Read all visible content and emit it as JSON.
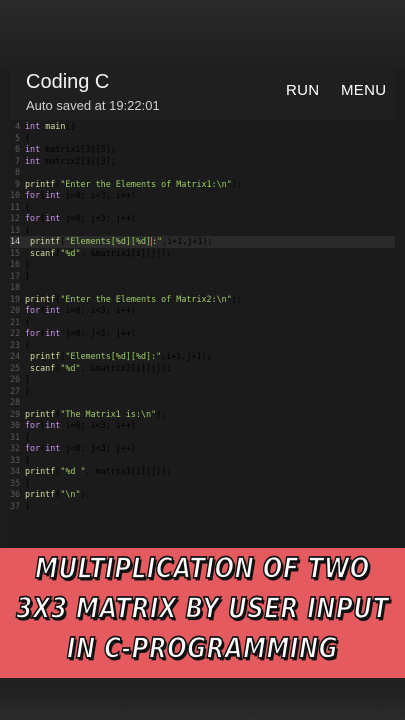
{
  "app": {
    "title": "Coding C",
    "autosave": "Auto saved at 19:22:01",
    "run_label": "RUN",
    "menu_label": "MENU"
  },
  "code_lines": [
    {
      "n": "4",
      "t": "int main()"
    },
    {
      "n": "5",
      "t": "{"
    },
    {
      "n": "6",
      "t": "int matrix1[3][3];"
    },
    {
      "n": "7",
      "t": "int matrix2[3][3];"
    },
    {
      "n": "8",
      "t": ""
    },
    {
      "n": "9",
      "t": "printf(\"Enter the Elements of Matrix1:\\n\");"
    },
    {
      "n": "10",
      "t": "for(int i=0; i<3; i++)"
    },
    {
      "n": "11",
      "t": "{"
    },
    {
      "n": "12",
      "t": "for(int j=0; j<3; j++)"
    },
    {
      "n": "13",
      "t": "{"
    },
    {
      "n": "14",
      "t": " printf(\"Elements[%d][%d]:\",i+1,j+1);"
    },
    {
      "n": "15",
      "t": " scanf(\"%d\", &matrix1[i][j]);"
    },
    {
      "n": "16",
      "t": "}"
    },
    {
      "n": "17",
      "t": "}"
    },
    {
      "n": "18",
      "t": ""
    },
    {
      "n": "19",
      "t": "printf(\"Enter the Elements of Matrix2:\\n\");"
    },
    {
      "n": "20",
      "t": "for(int i=0; i<3; i++)"
    },
    {
      "n": "21",
      "t": "{"
    },
    {
      "n": "22",
      "t": "for(int j=0; j<3; j++)"
    },
    {
      "n": "23",
      "t": "{"
    },
    {
      "n": "24",
      "t": " printf(\"Elements[%d][%d]:\",i+1,j+1);"
    },
    {
      "n": "25",
      "t": " scanf(\"%d\", &matrix2[i][j]);"
    },
    {
      "n": "26",
      "t": "}"
    },
    {
      "n": "27",
      "t": "}"
    },
    {
      "n": "28",
      "t": ""
    },
    {
      "n": "29",
      "t": "printf(\"The Matrix1 is:\\n\");"
    },
    {
      "n": "30",
      "t": "for(int i=0; i<3; i++)"
    },
    {
      "n": "31",
      "t": "{"
    },
    {
      "n": "32",
      "t": "for(int j=0; j<3; j++)"
    },
    {
      "n": "33",
      "t": "{"
    },
    {
      "n": "34",
      "t": "printf(\"%d \", matrix1[i][j]);"
    },
    {
      "n": "35",
      "t": "}"
    },
    {
      "n": "36",
      "t": "printf(\"\\n\");"
    },
    {
      "n": "37",
      "t": "}"
    }
  ],
  "active_line": "14",
  "banner": {
    "line1": "MULTIPLICATION OF TWO",
    "line2": "3X3 MATRIX BY USER INPUT",
    "line3": "IN C-PROGRAMMING"
  },
  "colors": {
    "banner_bg": "#e55a5f",
    "keyword": "#c792ea",
    "string": "#9ccc65",
    "cursor": "#ff4d4d"
  }
}
